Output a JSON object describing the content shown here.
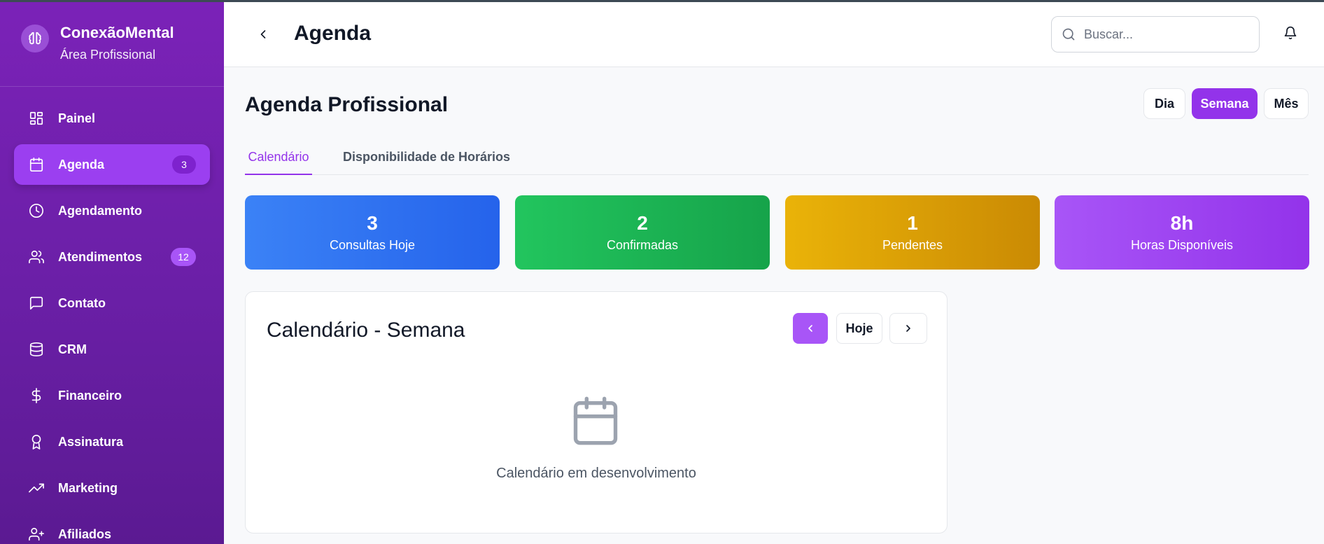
{
  "brand": {
    "name": "ConexãoMental",
    "subtitle": "Área Profissional"
  },
  "sidebar": {
    "items": [
      {
        "label": "Painel",
        "icon": "dashboard-icon"
      },
      {
        "label": "Agenda",
        "icon": "calendar-icon",
        "badge": "3",
        "active": true
      },
      {
        "label": "Agendamento",
        "icon": "clock-icon"
      },
      {
        "label": "Atendimentos",
        "icon": "users-icon",
        "badge": "12"
      },
      {
        "label": "Contato",
        "icon": "message-icon"
      },
      {
        "label": "CRM",
        "icon": "database-icon"
      },
      {
        "label": "Financeiro",
        "icon": "dollar-icon"
      },
      {
        "label": "Assinatura",
        "icon": "award-icon"
      },
      {
        "label": "Marketing",
        "icon": "trending-up-icon"
      },
      {
        "label": "Afiliados",
        "icon": "user-plus-icon"
      }
    ]
  },
  "header": {
    "title": "Agenda",
    "search_placeholder": "Buscar..."
  },
  "main": {
    "title": "Agenda Profissional",
    "view_options": [
      "Dia",
      "Semana",
      "Mês"
    ],
    "active_view": "Semana",
    "tabs": [
      {
        "label": "Calendário",
        "active": true
      },
      {
        "label": "Disponibilidade de Horários",
        "active": false
      }
    ],
    "stats": [
      {
        "value": "3",
        "label": "Consultas Hoje",
        "color": "#3b82f6"
      },
      {
        "value": "2",
        "label": "Confirmadas",
        "color": "#22c55e"
      },
      {
        "value": "1",
        "label": "Pendentes",
        "color": "#eab308"
      },
      {
        "value": "8h",
        "label": "Horas Disponíveis",
        "color": "#a855f7"
      }
    ],
    "calendar": {
      "title": "Calendário - Semana",
      "today_label": "Hoje",
      "empty_message": "Calendário em desenvolvimento"
    }
  },
  "colors": {
    "accent": "#9333ea",
    "sidebar_bg": "#6a1fa6"
  }
}
